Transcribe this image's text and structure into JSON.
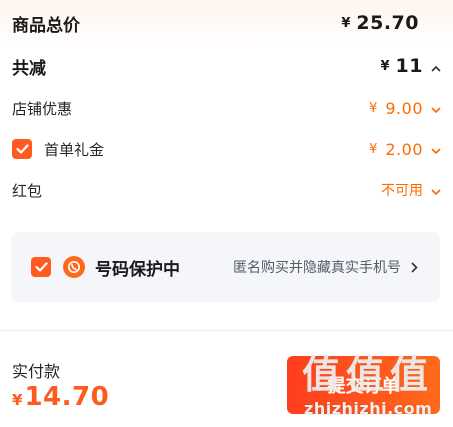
{
  "summary": {
    "total_label": "商品总价",
    "total_currency": "¥",
    "total_amount": "25.70",
    "discount_label": "共减",
    "discount_currency": "¥",
    "discount_amount": "11"
  },
  "items": [
    {
      "label": "店铺优惠",
      "currency": "¥",
      "value": "9.00"
    },
    {
      "label": "首单礼金",
      "currency": "¥",
      "value": "2.00",
      "checked": true
    },
    {
      "label": "红包",
      "value": "不可用"
    }
  ],
  "privacy": {
    "title": "号码保护中",
    "description": "匿名购买并隐藏真实手机号",
    "checked": true
  },
  "footer": {
    "paid_label": "实付款",
    "currency": "¥",
    "amount": "14.70",
    "submit_label": "提交订单"
  },
  "watermark": {
    "glyphs": "值值值",
    "domain": "zhizhizhi.com"
  },
  "colors": {
    "accent": "#ff6a00",
    "checkbox": "#ff5a1f",
    "card_bg": "#f4f6fa"
  }
}
